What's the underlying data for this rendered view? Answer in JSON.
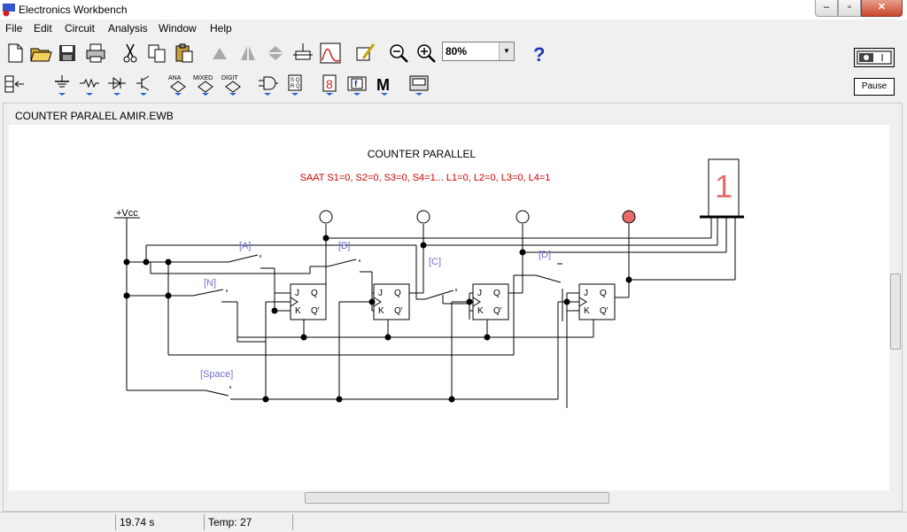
{
  "window": {
    "title": "Electronics Workbench"
  },
  "menu": [
    "File",
    "Edit",
    "Circuit",
    "Analysis",
    "Window",
    "Help"
  ],
  "toolbar": {
    "zoom_value": "80%",
    "pause_label": "Pause",
    "power_label": "I"
  },
  "document": {
    "title": "COUNTER PARALEL AMIR.EWB"
  },
  "circuit": {
    "heading": "COUNTER PARALLEL",
    "status_line": "SAAT S1=0, S2=0, S3=0, S4=1... L1=0, L2=0, L3=0, L4=1",
    "vcc_label": "+Vcc",
    "key_labels": [
      "[A]",
      "[B]",
      "[C]",
      "[D]",
      "[N]",
      "[Space]"
    ],
    "ff_pin_j": "J",
    "ff_pin_q": "Q",
    "ff_pin_k": "K",
    "ff_pin_qn": "Q'",
    "display_digit": "1",
    "probe_states": [
      "off",
      "off",
      "off",
      "on"
    ],
    "colors": {
      "probe_on": "#e86b6b",
      "label_blue": "#7070d0",
      "status_red": "#cc0000"
    }
  },
  "status": {
    "time": "19.74 s",
    "temp": "Temp:  27"
  }
}
